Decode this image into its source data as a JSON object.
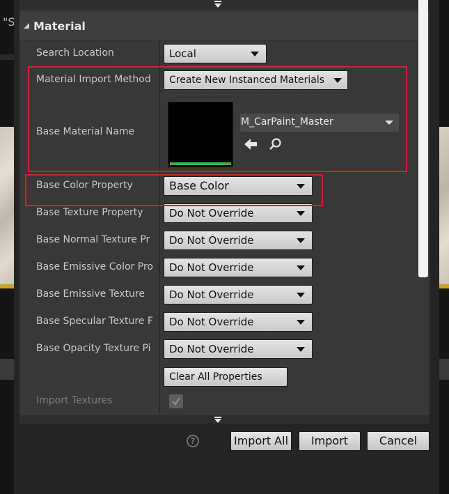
{
  "background": {
    "quote_fragment": "\"S"
  },
  "section": {
    "title": "Material"
  },
  "rows": {
    "search_location": {
      "label": "Search Location",
      "value": "Local"
    },
    "import_method": {
      "label": "Material Import Method",
      "value": "Create New Instanced Materials"
    },
    "base_material": {
      "label": "Base Material Name",
      "asset": "M_CarPaint_Master"
    },
    "base_color": {
      "label": "Base Color Property",
      "value": "Base Color"
    },
    "base_texture": {
      "label": "Base Texture Property",
      "value": "Do Not Override"
    },
    "base_normal": {
      "label": "Base Normal Texture Pr",
      "value": "Do Not Override"
    },
    "base_emissive_color": {
      "label": "Base Emissive Color Pro",
      "value": "Do Not Override"
    },
    "base_emissive_texture": {
      "label": "Base Emissive Texture",
      "value": "Do Not Override"
    },
    "base_specular": {
      "label": "Base Specular Texture F",
      "value": "Do Not Override"
    },
    "base_opacity": {
      "label": "Base Opacity Texture Pi",
      "value": "Do Not Override"
    },
    "clear_all": {
      "label": "Clear All Properties"
    },
    "import_textures": {
      "label": "Import Textures",
      "checked": true
    }
  },
  "footer": {
    "help_glyph": "?",
    "import_all": "Import All",
    "import": "Import",
    "cancel": "Cancel"
  },
  "icons": {
    "back_arrow": "arrow-left-icon",
    "browse": "magnifier-icon",
    "expand": "triangle-down-icon"
  },
  "colors": {
    "highlight": "#d4202a",
    "thumbnail_bar": "#3ab34a"
  }
}
